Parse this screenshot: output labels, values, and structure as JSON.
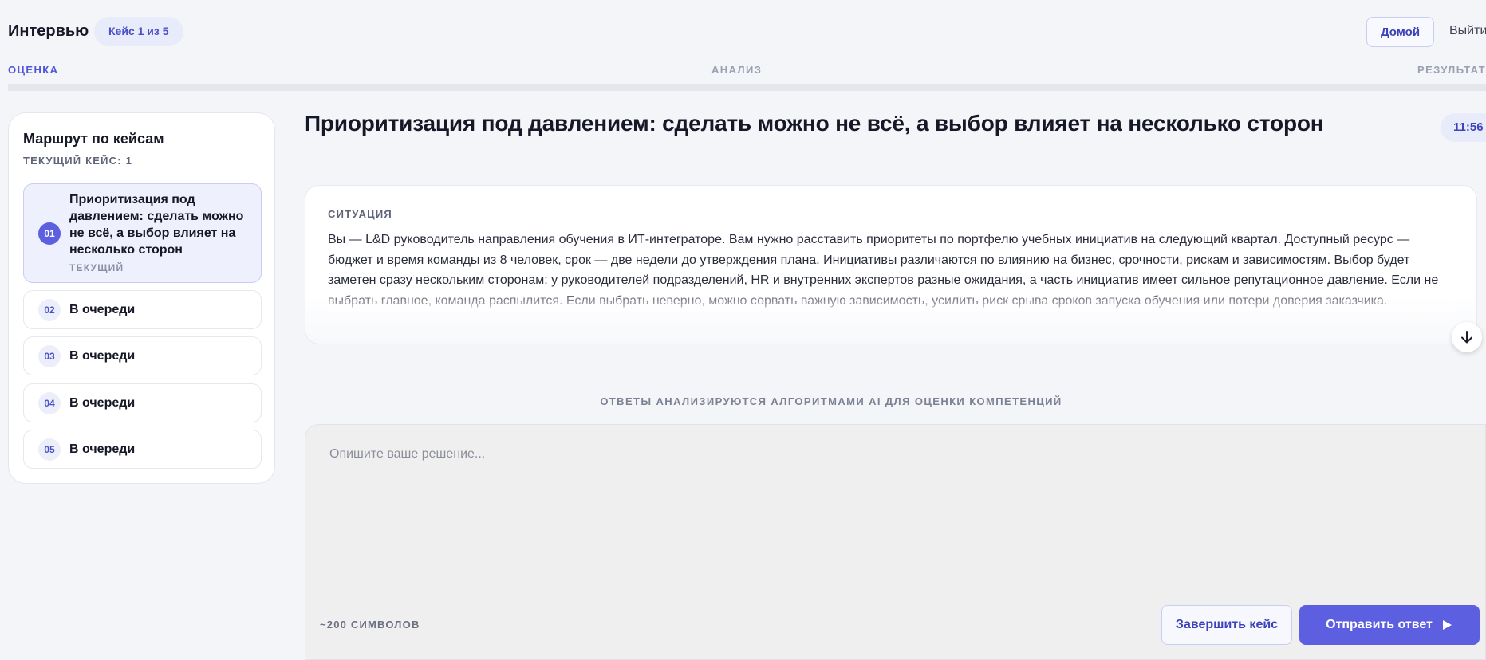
{
  "header": {
    "app_title": "Интервью",
    "case_counter": "Кейс 1 из 5",
    "home_label": "Домой",
    "logout_label": "Выйти"
  },
  "stages": [
    {
      "label": "ОЦЕНКА",
      "active": true
    },
    {
      "label": "АНАЛИЗ",
      "active": false
    },
    {
      "label": "РЕЗУЛЬТАТ",
      "active": false
    }
  ],
  "sidebar": {
    "title": "Маршрут по кейсам",
    "current_case": "ТЕКУЩИЙ КЕЙС: 1",
    "cases": [
      {
        "num": "01",
        "label": "Приоритизация под давлением: сделать можно не всё, а выбор влияет на несколько сторон",
        "state": "ТЕКУЩИЙ"
      },
      {
        "num": "02",
        "label": "В очереди"
      },
      {
        "num": "03",
        "label": "В очереди"
      },
      {
        "num": "04",
        "label": "В очереди"
      },
      {
        "num": "05",
        "label": "В очереди"
      }
    ]
  },
  "main": {
    "case_title": "Приоритизация под давлением: сделать можно не всё, а выбор влияет на несколько сторон",
    "timer": "11:56",
    "situation_label": "СИТУАЦИЯ",
    "situation_text": "Вы — L&D руководитель направления обучения в ИТ-интеграторе. Вам нужно расставить приоритеты по портфелю учебных инициатив на следующий квартал. Доступный ресурс — бюджет и время команды из 8 человек, срок — две недели до утверждения плана. Инициативы различаются по влиянию на бизнес, срочности, рискам и зависимостям. Выбор будет заметен сразу нескольким сторонам: у руководителей подразделений, HR и внутренних экспертов разные ожидания, а часть инициатив имеет сильное репутационное давление. Если не выбрать главное, команда распылится. Если выбрать неверно, можно сорвать важную зависимость, усилить риск срыва сроков запуска обучения или потери доверия заказчика.",
    "ai_note": "ОТВЕТЫ АНАЛИЗИРУЮТСЯ АЛГОРИТМАМИ AI ДЛЯ ОЦЕНКИ КОМПЕТЕНЦИЙ",
    "answer_placeholder": "Опишите ваше решение...",
    "answer_value": "",
    "char_hint": "~200 СИМВОЛОВ",
    "finish_label": "Завершить кейс",
    "send_label": "Отправить ответ"
  },
  "icons": {
    "scroll": "arrow-down-icon",
    "send": "play-triangle-icon"
  },
  "colors": {
    "accent": "#5b5fe0",
    "accent_text": "#4a50c8",
    "pill_bg": "#e8ebfa",
    "page_bg": "#f4f5f8"
  }
}
